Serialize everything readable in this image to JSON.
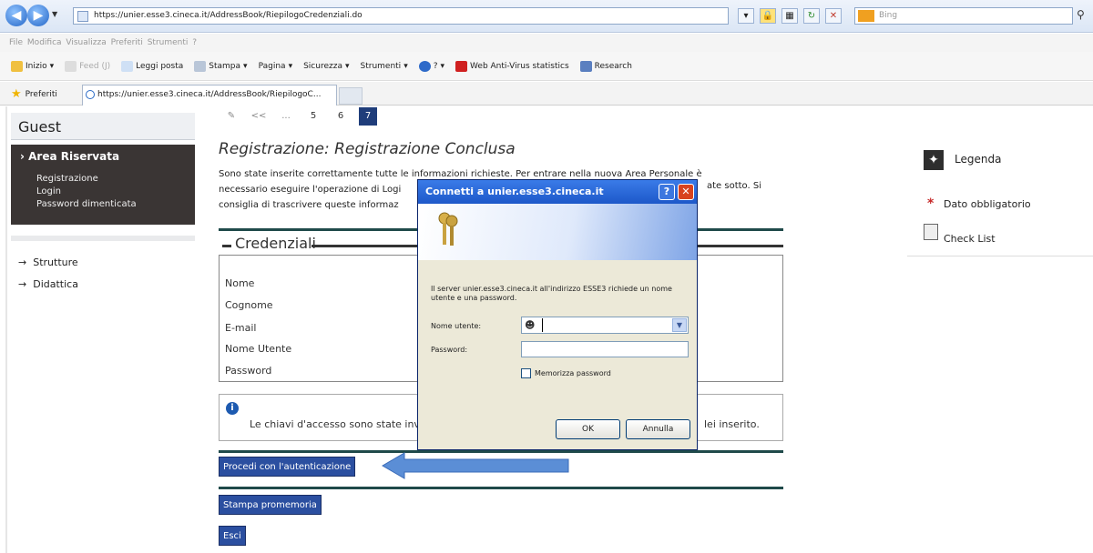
{
  "browser": {
    "url": "https://unier.esse3.cineca.it/AddressBook/RiepilogoCredenziali.do",
    "search_placeholder": "Bing",
    "menu": "File   Modifica   Visualizza   Preferiti   Strumenti   ?",
    "commands": [
      "Inizio",
      "Feed (J)",
      "Leggi posta",
      "Stampa",
      "Pagina",
      "Sicurezza",
      "Strumenti",
      "?",
      "Web Anti-Virus statistics",
      "Research"
    ],
    "favorites_label": "Preferiti",
    "tab_title": "https://unier.esse3.cineca.it/AddressBook/RiepilogoC..."
  },
  "sidebar": {
    "guest": "Guest",
    "area_title": "Area Riservata",
    "area_links": [
      "Registrazione",
      "Login",
      "Password dimenticata"
    ],
    "menu": [
      "Strutture",
      "Didattica"
    ]
  },
  "pager": {
    "prev": "<<",
    "dots": "...",
    "pages": [
      "5",
      "6",
      "7"
    ],
    "current": "7"
  },
  "main": {
    "title": "Registrazione: Registrazione Conclusa",
    "intro_lines": [
      "Sono state inserite correttamente tutte le informazioni richieste. Per entrare nella nuova Area Personale è",
      "necessario eseguire l'operazione di Logi",
      "consiglia di trascrivere queste informaz"
    ],
    "intro_tail": "ate sotto. Si",
    "credentials_title": "Credenziali",
    "credential_labels": [
      "Nome",
      "Cognome",
      "E-mail",
      "Nome Utente",
      "Password"
    ],
    "info_text": "Le chiavi d'accesso sono state inv",
    "info_text_tail": "lei inserito.",
    "buttons": {
      "authenticate": "Procedi con l'autenticazione",
      "print": "Stampa promemoria",
      "exit": "Esci"
    }
  },
  "legend": {
    "title": "Legenda",
    "required": "Dato obbligatorio",
    "checklist": "Check List"
  },
  "dialog": {
    "title": "Connetti a unier.esse3.cineca.it",
    "message": "Il server unier.esse3.cineca.it all'indirizzo ESSE3 richiede un nome utente e una password.",
    "username_label": "Nome utente:",
    "username_value": "",
    "password_label": "Password:",
    "password_value": "",
    "remember_label": "Memorizza password",
    "remember_checked": false,
    "ok": "OK",
    "cancel": "Annulla"
  },
  "annotation": {
    "arrow_color": "#5b8ed6"
  }
}
